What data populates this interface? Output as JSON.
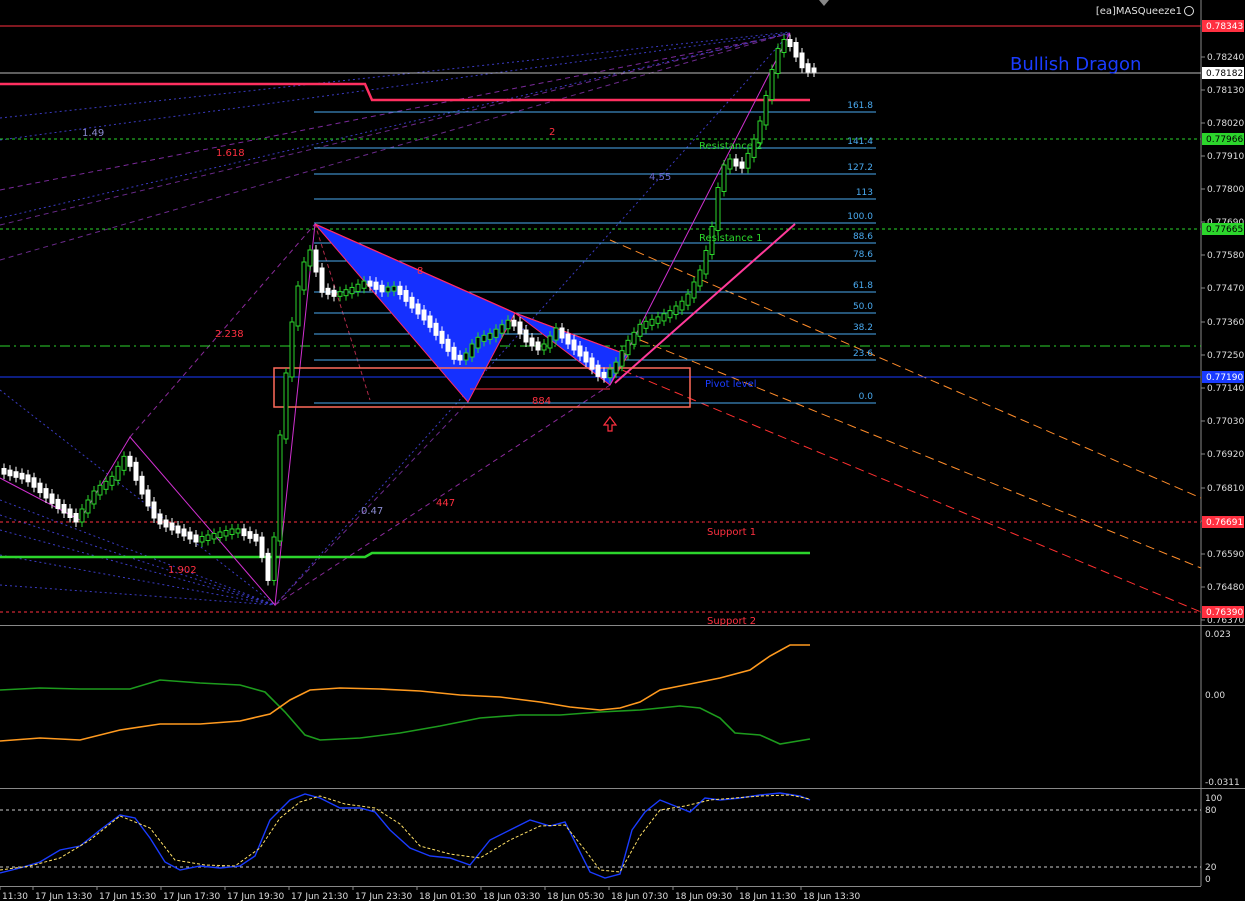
{
  "indicator_name": "[ea]MASQueeze1",
  "pattern_label": "Bullish Dragon",
  "price_axis": {
    "min": 0.7634,
    "max": 0.7839,
    "ticks": [
      "0.78240",
      "0.78130",
      "0.78020",
      "0.77910",
      "0.77800",
      "0.77690",
      "0.77580",
      "0.77470",
      "0.77360",
      "0.77250",
      "0.77140",
      "0.77030",
      "0.76920",
      "0.76810",
      "0.76700",
      "0.76590",
      "0.76480",
      "0.76370"
    ]
  },
  "price_badges": [
    {
      "value": "0.78343",
      "color": "#ff3040"
    },
    {
      "value": "0.78182",
      "color": "#ffffff"
    },
    {
      "value": "0.77966",
      "color": "#2cd52c"
    },
    {
      "value": "0.77665",
      "color": "#2cd52c"
    },
    {
      "value": "0.77190",
      "color": "#1a3cff"
    },
    {
      "value": "0.76691",
      "color": "#ff3040"
    },
    {
      "value": "0.76390",
      "color": "#ff3040"
    }
  ],
  "fib_levels": [
    "161.8",
    "141.4",
    "127.2",
    "113",
    "100.0",
    "88.6",
    "78.6",
    "61.8",
    "50.0",
    "38.2",
    "23.6",
    "0.0"
  ],
  "level_labels": {
    "resistance2": "Resistance 2",
    "resistance1": "Resistance 1",
    "pivot": "Pivot level",
    "support1": "Support 1",
    "support2": "Support 2"
  },
  "ratio_labels": [
    "1.49",
    "1.618",
    "2",
    "4.55",
    "2.238",
    "8",
    "0.47",
    "447",
    "1.902",
    "884"
  ],
  "macd_axis": [
    "0.023",
    "0.00",
    "-0.0311"
  ],
  "stoch_axis": [
    "100",
    "80",
    "20",
    "0"
  ],
  "time_labels": [
    "11:30",
    "17 Jun 13:30",
    "17 Jun 15:30",
    "17 Jun 17:30",
    "17 Jun 19:30",
    "17 Jun 21:30",
    "17 Jun 23:30",
    "18 Jun 01:30",
    "18 Jun 03:30",
    "18 Jun 05:30",
    "18 Jun 07:30",
    "18 Jun 09:30",
    "18 Jun 11:30",
    "18 Jun 13:30"
  ],
  "colors": {
    "bull": "#2cd52c",
    "bear": "#ffffff",
    "fib": "#4aaaf0",
    "resistance": "#2cd52c",
    "support": "#ff3040",
    "pattern_fill": "#1530ff",
    "macd_orange": "#ff9a1f",
    "macd_green": "#1d9b1d",
    "stoch_main": "#1a3cff",
    "stoch_signal": "#ffe066"
  }
}
